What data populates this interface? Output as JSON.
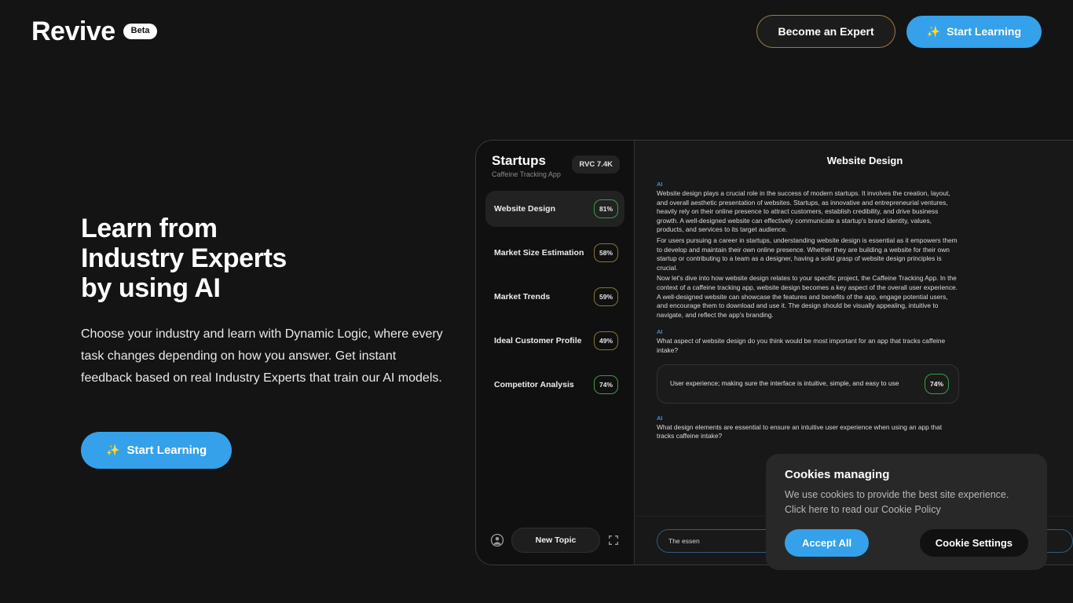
{
  "header": {
    "brand_name": "Revive",
    "beta_label": "Beta",
    "become_expert_label": "Become an Expert",
    "start_learning_label": "Start Learning",
    "sparkle": "✨",
    "accent_blue": "#34a1ea",
    "expert_border": "#9a7b3e"
  },
  "hero": {
    "heading_line1": "Learn from",
    "heading_line2": "Industry Experts",
    "heading_line3": "by using AI",
    "body": "Choose your industry and learn with Dynamic Logic, where every task changes depending on how you answer. Get instant feedback based on real Industry Experts that train our AI models.",
    "cta_label": "Start Learning",
    "sparkle": "✨"
  },
  "mockup": {
    "sidebar": {
      "title": "Startups",
      "subtitle": "Caffeine Tracking App",
      "rvc_badge": "RVC 7.4K",
      "items": [
        {
          "label": "Website Design",
          "percent": "81%",
          "tone": "green",
          "active": true
        },
        {
          "label": "Market Size Estimation",
          "percent": "58%",
          "tone": "amber",
          "active": false
        },
        {
          "label": "Market Trends",
          "percent": "59%",
          "tone": "amber",
          "active": false
        },
        {
          "label": "Ideal Customer Profile",
          "percent": "49%",
          "tone": "amber",
          "active": false
        },
        {
          "label": "Competitor Analysis",
          "percent": "74%",
          "tone": "green",
          "active": false
        }
      ],
      "new_topic_label": "New Topic"
    },
    "chat": {
      "title": "Website Design",
      "ai_tag": "AI",
      "message1_p1": "Website design plays a crucial role in the success of modern startups. It involves the creation, layout, and overall aesthetic presentation of websites. Startups, as innovative and entrepreneurial ventures, heavily rely on their online presence to attract customers, establish credibility, and drive business growth. A well-designed website can effectively communicate a startup's brand identity, values, products, and services to its target audience.",
      "message1_p2": "For users pursuing a career in startups, understanding website design is essential as it empowers them to develop and maintain their own online presence. Whether they are building a website for their own startup or contributing to a team as a designer, having a solid grasp of website design principles is crucial.",
      "message1_p3": "Now let's dive into how website design relates to your specific project, the Caffeine Tracking App. In the context of a caffeine tracking app, website design becomes a key aspect of the overall user experience. A well-designed website can showcase the features and benefits of the app, engage potential users, and encourage them to download and use it. The design should be visually appealing, intuitive to navigate, and reflect the app's branding.",
      "question1": "What aspect of website design do you think would be most important for an app that tracks caffeine intake?",
      "answer1": "User experience; making sure the interface is intuitive, simple, and easy to use",
      "answer1_percent": "74%",
      "question2": "What design elements are essential to ensure an intuitive user experience when using an app that tracks caffeine intake?",
      "input_value": "The essen"
    }
  },
  "cookies": {
    "title": "Cookies managing",
    "line1": "We use cookies to provide the best site experience.",
    "line2": "Click here to read our Cookie Policy",
    "accept_label": "Accept All",
    "settings_label": "Cookie Settings"
  }
}
